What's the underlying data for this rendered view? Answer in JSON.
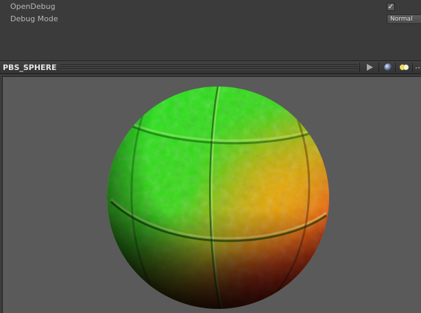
{
  "inspector": {
    "open_debug_label": "OpenDebug",
    "open_debug_checked": true,
    "debug_mode_label": "Debug Mode",
    "debug_mode_value": "Normal"
  },
  "preview": {
    "title": "PBS_SPHERE",
    "play_icon": "play-icon",
    "sphere_icon": "sphere-icon",
    "lights_icon": "lights-icon",
    "menu_icon": "dropdown-menu-icon"
  },
  "colors": {
    "inspector_bg": "#3b3b3b",
    "viewport_bg": "#5a5a5a",
    "sphere_green": "#1fe01f",
    "sphere_red": "#ff1000"
  }
}
